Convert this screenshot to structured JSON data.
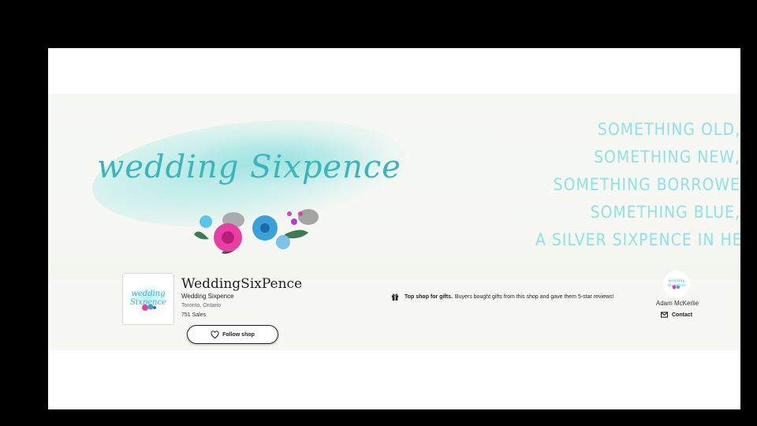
{
  "banner": {
    "logo_text": "wedding Sixpence",
    "poem": [
      "SOMETHING OLD,",
      "SOMETHING NEW,",
      "SOMETHING BORROWE",
      "SOMETHING BLUE,",
      "A SILVER SIXPENCE IN HE"
    ]
  },
  "shop": {
    "avatar_text": "wedding Sixpence",
    "name": "WeddingSixPence",
    "subtitle": "Wedding Sixpence",
    "location": "Toronto, Ontario",
    "sales": "751 Sales",
    "follow_label": "Follow shop"
  },
  "gift_note": {
    "bold": "Top shop for gifts.",
    "text": "Buyers bought gifts from this shop and gave them 5-star reviews!"
  },
  "owner": {
    "name": "Adam McKerlie",
    "contact_label": "Contact"
  },
  "colors": {
    "accent": "#3bb5b8",
    "poem": "#8fe3df",
    "flower_pink": "#e83fa5",
    "flower_blue": "#3aa0d8"
  }
}
